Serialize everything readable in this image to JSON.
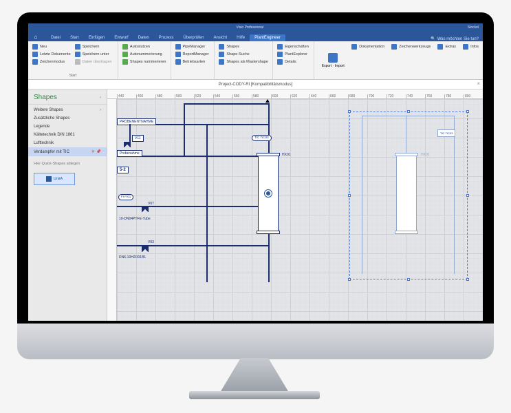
{
  "app_title": "Visio Professional",
  "title_right": "Stockel",
  "tabs": [
    "Datei",
    "Start",
    "Einfügen",
    "Entwurf",
    "Daten",
    "Prozess",
    "Überprüfen",
    "Ansicht",
    "Hilfe",
    "PlantEngineer"
  ],
  "active_tab": 9,
  "tell_me": "Was möchten Sie tun?",
  "ribbon": {
    "g1": {
      "label": "Start",
      "c1": [
        "Neu",
        "Letzte Dokumente",
        "Zeichenmodus"
      ],
      "c2": [
        "Speichern",
        "Speichern unter",
        "Daten übertragen"
      ]
    },
    "g2": {
      "c1": [
        "Autostutzen",
        "Autonummerierung",
        "Shapes nummerieren"
      ]
    },
    "g3": {
      "c1": [
        "PipeManager",
        "ReportManager",
        "Betriebsarten"
      ]
    },
    "g4": {
      "c1": [
        "Shapes",
        "Shape-Suche",
        "Shapes als Mastershape"
      ]
    },
    "g5": {
      "c1": [
        "Eigenschaften",
        "PlantExplorer",
        "Details"
      ]
    },
    "g6": {
      "big": "Export · Import",
      "c1": [
        "Dokumentation",
        "Zeichenwerkzeuge",
        "Extras",
        "Infos"
      ]
    }
  },
  "document_title": "Project-CODY-RI  [Kompatibilitätsmodus]",
  "ruler_h": [
    "440",
    "460",
    "480",
    "500",
    "520",
    "540",
    "560",
    "580",
    "600",
    "620",
    "640",
    "660",
    "680",
    "700",
    "720",
    "740",
    "760",
    "780",
    "800"
  ],
  "shapes_panel": {
    "title": "Shapes",
    "items": [
      "Weitere Shapes",
      "Zusätzliche Shapes",
      "Legende",
      "Kältetechnik DIN 1861",
      "Lufttechnik",
      "Verdampfer mit TIC"
    ],
    "selected": 5,
    "quick_hint": "Hier Quick-Shapes ablegen",
    "quick_shape": "UnitA"
  },
  "diagram": {
    "probenentnahme1": "PROBENENTNAHME",
    "probenahme": "Probenahme",
    "v11": "V11",
    "v07": "V07",
    "v03": "V03",
    "box52": "5-2",
    "pipe1": "10-DN04PTFE-Tube",
    "pipe2": "DN6-10H2O01B1",
    "fi": "FI  FI01",
    "tic": "TIC TIC03",
    "tic_sel": "TIC TIC03",
    "hx": "HX01"
  }
}
